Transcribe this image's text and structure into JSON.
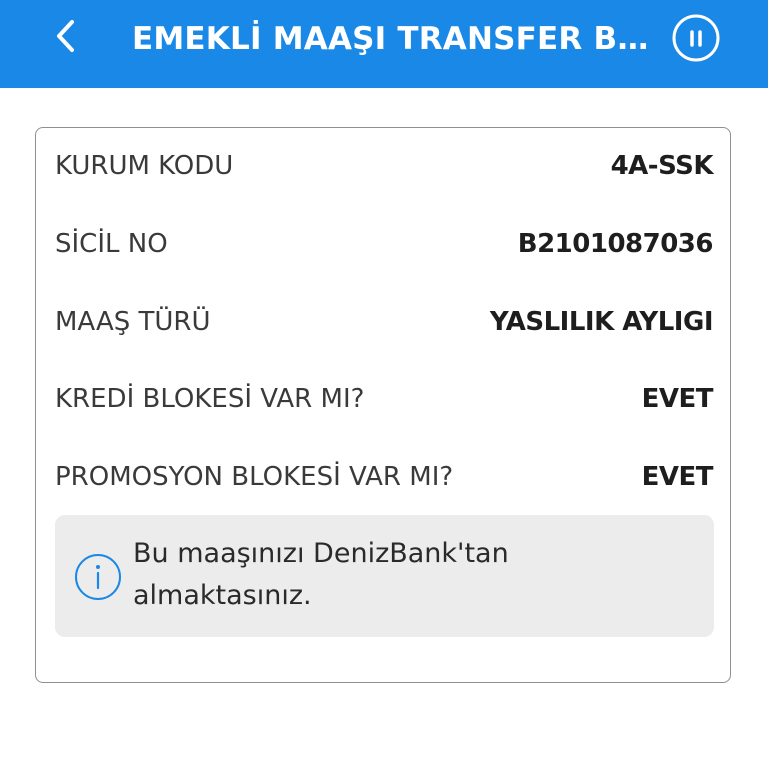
{
  "header": {
    "title": "EMEKLİ MAAŞI TRANSFER BAŞ...",
    "back_icon": "chevron-left-icon",
    "pause_icon": "pause-circle-icon",
    "background_color": "#1a88e6"
  },
  "details": {
    "rows": [
      {
        "label": "KURUM KODU",
        "value": "4A-SSK"
      },
      {
        "label": "SİCİL NO",
        "value": "B2101087036"
      },
      {
        "label": "MAAŞ TÜRÜ",
        "value": "YASLILIK AYLIGI"
      },
      {
        "label": "KREDİ BLOKESİ VAR MI?",
        "value": "EVET"
      },
      {
        "label": "PROMOSYON BLOKESİ VAR MI?",
        "value": "EVET"
      }
    ]
  },
  "info": {
    "icon": "info-icon",
    "text": "Bu maaşınızı DenizBank'tan almaktasınız.",
    "accent_color": "#1a88e6"
  }
}
